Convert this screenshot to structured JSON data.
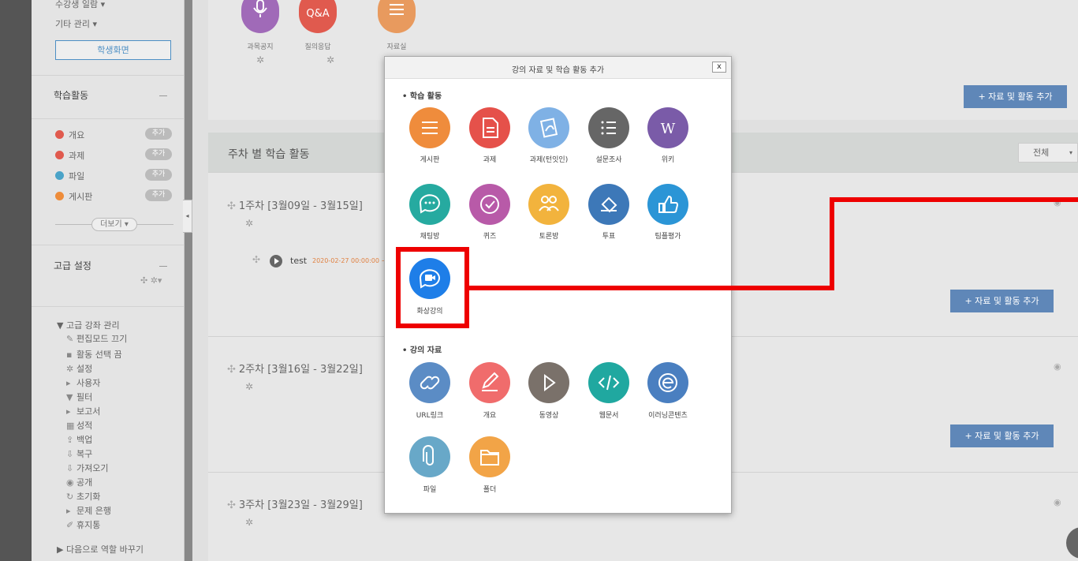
{
  "sidebar": {
    "top_item": "수강생 일람 ▾",
    "other_manage": "기타 관리 ▾",
    "student_view": "학생화면",
    "activities_title": "학습활동",
    "activities": [
      {
        "label": "개요",
        "color": "#e05a4e",
        "add": "추가"
      },
      {
        "label": "과제",
        "color": "#e05a4e",
        "add": "추가"
      },
      {
        "label": "파일",
        "color": "#4aa3c8",
        "add": "추가"
      },
      {
        "label": "게시판",
        "color": "#ee8c3a",
        "add": "추가"
      }
    ],
    "more": "더보기 ▾",
    "advanced_title": "고급 설정",
    "admin_title": "▼ 고급 강좌 관리",
    "admin_items": [
      "편집모드 끄기",
      "활동 선택 끔",
      "설정",
      "사용자",
      "필터",
      "보고서",
      "성적",
      "백업",
      "복구",
      "가져오기",
      "공개",
      "초기화",
      "문제 은행",
      "휴지통"
    ],
    "switch_role": "▶ 다음으로 역할 바꾸기"
  },
  "top_panel": {
    "items": [
      {
        "label": "과목공지",
        "icon": "microphone-icon",
        "color": "#a06ab8"
      },
      {
        "label": "질의응답",
        "icon": "qa-icon",
        "color": "#e05a4e",
        "text": "Q&A"
      },
      {
        "label": "자료실",
        "icon": "list-icon",
        "color": "#e89a5e"
      }
    ],
    "add_button": "+ 자료 및 활동 추가"
  },
  "weekly": {
    "title": "주차 별 학습 활동",
    "filter": "전체",
    "filter_arrow": "▾",
    "weeks": [
      {
        "title": "1주차 [3월09일 - 3월15일]",
        "add_button": "+ 자료 및 활동 추가"
      },
      {
        "title": "2주차 [3월16일 - 3월22일]",
        "add_button": "+ 자료 및 활동 추가"
      },
      {
        "title": "3주차 [3월23일 - 3월29일]"
      }
    ],
    "test_item": {
      "name": "test",
      "date": "2020-02-27 00:00:00 ~"
    }
  },
  "modal": {
    "title": "강의 자료 및 학습 활동 추가",
    "close": "x",
    "section_activities": "• 학습 활동",
    "activities": [
      {
        "label": "게시판",
        "icon": "board-icon",
        "color": "#ef8c3c"
      },
      {
        "label": "과제",
        "icon": "assignment-icon",
        "color": "#e5514a"
      },
      {
        "label": "과제(턴잇인)",
        "icon": "turnitin-icon",
        "color": "#7fb1e5"
      },
      {
        "label": "설문조사",
        "icon": "survey-icon",
        "color": "#666666"
      },
      {
        "label": "위키",
        "icon": "wiki-icon",
        "color": "#7a5ba8"
      },
      {
        "label": "채팅방",
        "icon": "chat-icon",
        "color": "#26aaa0"
      },
      {
        "label": "퀴즈",
        "icon": "quiz-icon",
        "color": "#b85aa8"
      },
      {
        "label": "토론방",
        "icon": "discussion-icon",
        "color": "#f2b33d"
      },
      {
        "label": "투표",
        "icon": "vote-icon",
        "color": "#3d78b8"
      },
      {
        "label": "팀플평가",
        "icon": "thumbs-up-icon",
        "color": "#2b95d6"
      },
      {
        "label": "화상강의",
        "icon": "video-lecture-icon",
        "color": "#1e7ee8"
      }
    ],
    "section_materials": "• 강의 자료",
    "materials": [
      {
        "label": "URL링크",
        "icon": "link-icon",
        "color": "#5b8cc5"
      },
      {
        "label": "개요",
        "icon": "pencil-icon",
        "color": "#f06c6c"
      },
      {
        "label": "동영상",
        "icon": "play-icon",
        "color": "#7a716a"
      },
      {
        "label": "웹문서",
        "icon": "code-icon",
        "color": "#20a8a0"
      },
      {
        "label": "이러닝콘텐츠",
        "icon": "elearning-icon",
        "color": "#4a7fc0"
      },
      {
        "label": "파일",
        "icon": "paperclip-icon",
        "color": "#68a8c8"
      },
      {
        "label": "폴더",
        "icon": "folder-icon",
        "color": "#f2a447"
      }
    ]
  },
  "annotation": {
    "highlight_color": "#ee0000"
  }
}
